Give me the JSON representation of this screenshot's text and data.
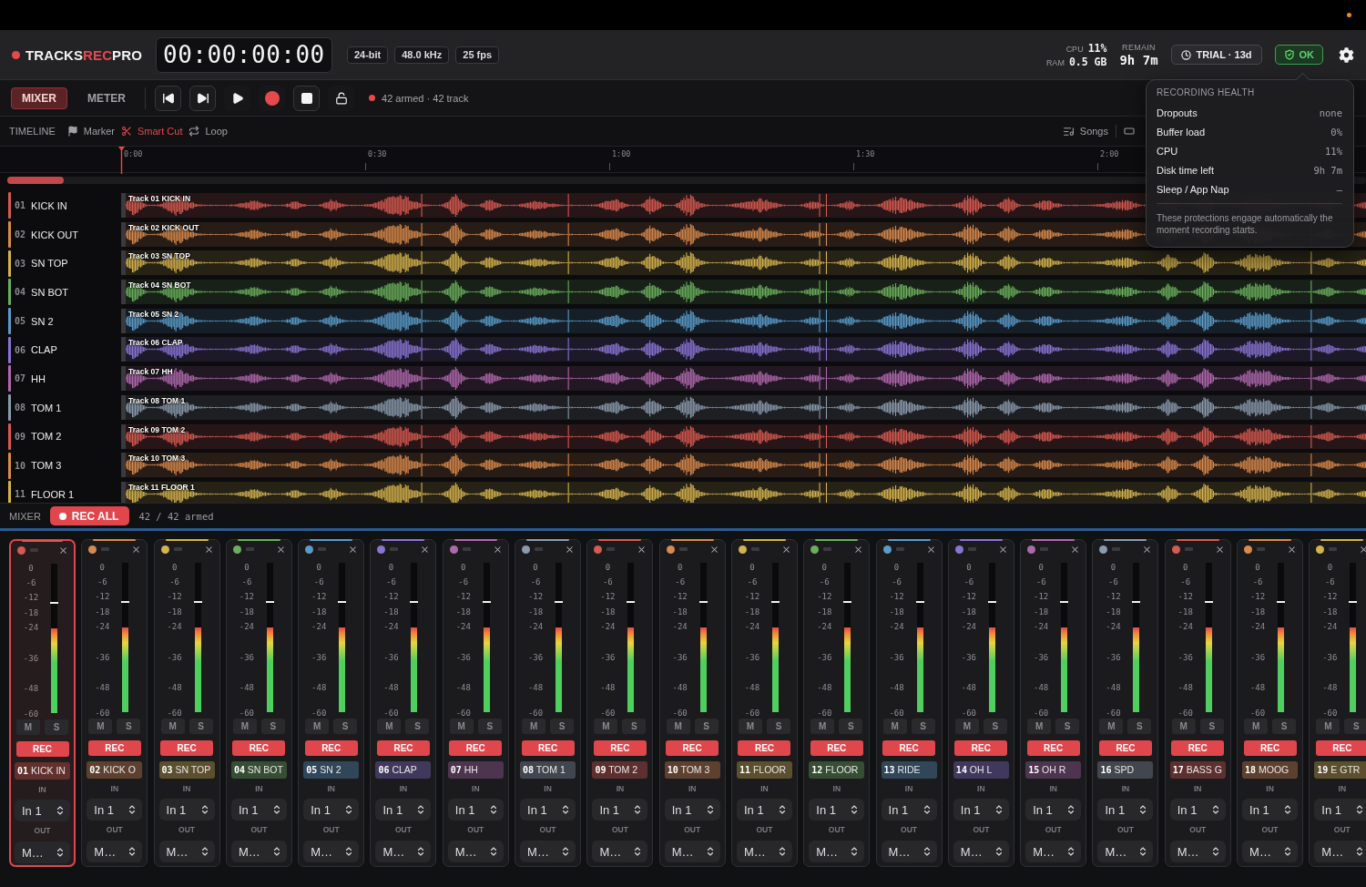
{
  "header": {
    "logo": [
      {
        "text": "TRACKS",
        "accent": false
      },
      {
        "text": "REC",
        "accent": true
      },
      {
        "text": "PRO",
        "accent": false
      }
    ],
    "timecode": "00:00:00:00",
    "format_badges": [
      "24-bit",
      "48.0 kHz",
      "25 fps"
    ],
    "stats": [
      {
        "label": "CPU",
        "value": "11%"
      },
      {
        "label": "RAM",
        "value": "0.5 GB"
      }
    ],
    "remain": {
      "label": "REMAIN",
      "value": "9h 7m"
    },
    "trial_button": "TRIAL · 13d",
    "health_button": {
      "label": "OK",
      "healthy": true
    }
  },
  "transport": {
    "view_tabs": [
      {
        "label": "MIXER",
        "selected": true
      },
      {
        "label": "METER",
        "selected": false
      }
    ],
    "status": "42 armed · 42 track"
  },
  "timeline_toolbar": {
    "title": "TIMELINE",
    "tools": [
      {
        "kind": "marker",
        "label": "Marker",
        "active": false
      },
      {
        "kind": "cut",
        "label": "Smart Cut",
        "active": true
      },
      {
        "kind": "loop",
        "label": "Loop",
        "active": false
      }
    ],
    "songs_button": "Songs"
  },
  "ruler": {
    "labels": [
      "0:00",
      "0:30",
      "1:00",
      "1:30",
      "2:00"
    ]
  },
  "tracks": [
    {
      "number": "01",
      "name": "KICK IN",
      "color": "#d65a50",
      "clip_label": "Track 01 KICK IN"
    },
    {
      "number": "02",
      "name": "KICK OUT",
      "color": "#d98a4c",
      "clip_label": "Track 02 KICK OUT"
    },
    {
      "number": "03",
      "name": "SN TOP",
      "color": "#d4b24c",
      "clip_label": "Track 03 SN TOP"
    },
    {
      "number": "04",
      "name": "SN BOT",
      "color": "#6aaf5c",
      "clip_label": "Track 04 SN BOT"
    },
    {
      "number": "05",
      "name": "SN 2",
      "color": "#5a9bc8",
      "clip_label": "Track 05 SN 2"
    },
    {
      "number": "06",
      "name": "CLAP",
      "color": "#8a74d4",
      "clip_label": "Track 06 CLAP"
    },
    {
      "number": "07",
      "name": "HH",
      "color": "#b068ad",
      "clip_label": "Track 07 HH"
    },
    {
      "number": "08",
      "name": "TOM 1",
      "color": "#8b9aac",
      "clip_label": "Track 08 TOM 1"
    },
    {
      "number": "09",
      "name": "TOM 2",
      "color": "#d65a50",
      "clip_label": "Track 09 TOM 2"
    },
    {
      "number": "10",
      "name": "TOM 3",
      "color": "#d98a4c",
      "clip_label": "Track 10 TOM 3"
    },
    {
      "number": "11",
      "name": "FLOOR 1",
      "color": "#d4b24c",
      "clip_label": "Track 11 FLOOR 1"
    }
  ],
  "health_popover": {
    "title": "RECORDING HEALTH",
    "rows": [
      {
        "label": "Dropouts",
        "value": "none"
      },
      {
        "label": "Buffer load",
        "value": "0%"
      },
      {
        "label": "CPU",
        "value": "11%"
      },
      {
        "label": "Disk time left",
        "value": "9h 7m"
      },
      {
        "label": "Sleep / App Nap",
        "value": "–"
      }
    ],
    "note": "These protections engage automatically the moment recording starts."
  },
  "mixer": {
    "title": "MIXER",
    "rec_all_button": "REC ALL",
    "armed_count": "42 / 42 armed",
    "strips": [
      {
        "color": "#d65a50",
        "selected": true,
        "scale": [
          "0",
          "-6",
          "-12",
          "-18",
          "-24",
          "-36",
          "-48",
          "-60"
        ],
        "meter": {
          "level": 0.57
        },
        "marker": {
          "level": 0.74
        },
        "mute": "M",
        "muted": false,
        "solo": "S",
        "soloed": false,
        "rec": "REC",
        "armed": true,
        "label": "**01** KICK IN",
        "in_label": "IN",
        "input": "In 1",
        "out_label": "OUT",
        "output": "M…"
      },
      {
        "color": "#d98a4c",
        "selected": false,
        "scale": [
          "0",
          "-6",
          "-12",
          "-18",
          "-24",
          "-36",
          "-48",
          "-60"
        ],
        "meter": {
          "level": 0.57
        },
        "marker": {
          "level": 0.74
        },
        "mute": "M",
        "muted": false,
        "solo": "S",
        "soloed": false,
        "rec": "REC",
        "armed": true,
        "label": "**02** KICK O",
        "in_label": "IN",
        "input": "In 1",
        "out_label": "OUT",
        "output": "M…"
      },
      {
        "color": "#d4b24c",
        "selected": false,
        "scale": [
          "0",
          "-6",
          "-12",
          "-18",
          "-24",
          "-36",
          "-48",
          "-60"
        ],
        "meter": {
          "level": 0.57
        },
        "marker": {
          "level": 0.74
        },
        "mute": "M",
        "muted": false,
        "solo": "S",
        "soloed": false,
        "rec": "REC",
        "armed": true,
        "label": "**03** SN TOP",
        "in_label": "IN",
        "input": "In 1",
        "out_label": "OUT",
        "output": "M…"
      },
      {
        "color": "#6aaf5c",
        "selected": false,
        "scale": [
          "0",
          "-6",
          "-12",
          "-18",
          "-24",
          "-36",
          "-48",
          "-60"
        ],
        "meter": {
          "level": 0.57
        },
        "marker": {
          "level": 0.74
        },
        "mute": "M",
        "muted": false,
        "solo": "S",
        "soloed": false,
        "rec": "REC",
        "armed": true,
        "label": "**04** SN BOT",
        "in_label": "IN",
        "input": "In 1",
        "out_label": "OUT",
        "output": "M…"
      },
      {
        "color": "#5a9bc8",
        "selected": false,
        "scale": [
          "0",
          "-6",
          "-12",
          "-18",
          "-24",
          "-36",
          "-48",
          "-60"
        ],
        "meter": {
          "level": 0.57
        },
        "marker": {
          "level": 0.74
        },
        "mute": "M",
        "muted": false,
        "solo": "S",
        "soloed": false,
        "rec": "REC",
        "armed": true,
        "label": "**05** SN 2",
        "in_label": "IN",
        "input": "In 1",
        "out_label": "OUT",
        "output": "M…"
      },
      {
        "color": "#8a74d4",
        "selected": false,
        "scale": [
          "0",
          "-6",
          "-12",
          "-18",
          "-24",
          "-36",
          "-48",
          "-60"
        ],
        "meter": {
          "level": 0.57
        },
        "marker": {
          "level": 0.74
        },
        "mute": "M",
        "muted": false,
        "solo": "S",
        "soloed": false,
        "rec": "REC",
        "armed": true,
        "label": "**06** CLAP",
        "in_label": "IN",
        "input": "In 1",
        "out_label": "OUT",
        "output": "M…"
      },
      {
        "color": "#b068ad",
        "selected": false,
        "scale": [
          "0",
          "-6",
          "-12",
          "-18",
          "-24",
          "-36",
          "-48",
          "-60"
        ],
        "meter": {
          "level": 0.57
        },
        "marker": {
          "level": 0.74
        },
        "mute": "M",
        "muted": false,
        "solo": "S",
        "soloed": false,
        "rec": "REC",
        "armed": true,
        "label": "**07** HH",
        "in_label": "IN",
        "input": "In 1",
        "out_label": "OUT",
        "output": "M…"
      },
      {
        "color": "#8b9aac",
        "selected": false,
        "scale": [
          "0",
          "-6",
          "-12",
          "-18",
          "-24",
          "-36",
          "-48",
          "-60"
        ],
        "meter": {
          "level": 0.57
        },
        "marker": {
          "level": 0.74
        },
        "mute": "M",
        "muted": false,
        "solo": "S",
        "soloed": false,
        "rec": "REC",
        "armed": true,
        "label": "**08** TOM 1",
        "in_label": "IN",
        "input": "In 1",
        "out_label": "OUT",
        "output": "M…"
      },
      {
        "color": "#d65a50",
        "selected": false,
        "scale": [
          "0",
          "-6",
          "-12",
          "-18",
          "-24",
          "-36",
          "-48",
          "-60"
        ],
        "meter": {
          "level": 0.57
        },
        "marker": {
          "level": 0.74
        },
        "mute": "M",
        "muted": false,
        "solo": "S",
        "soloed": false,
        "rec": "REC",
        "armed": true,
        "label": "**09** TOM 2",
        "in_label": "IN",
        "input": "In 1",
        "out_label": "OUT",
        "output": "M…"
      },
      {
        "color": "#d98a4c",
        "selected": false,
        "scale": [
          "0",
          "-6",
          "-12",
          "-18",
          "-24",
          "-36",
          "-48",
          "-60"
        ],
        "meter": {
          "level": 0.57
        },
        "marker": {
          "level": 0.74
        },
        "mute": "M",
        "muted": false,
        "solo": "S",
        "soloed": false,
        "rec": "REC",
        "armed": true,
        "label": "**10** TOM 3",
        "in_label": "IN",
        "input": "In 1",
        "out_label": "OUT",
        "output": "M…"
      },
      {
        "color": "#d4b24c",
        "selected": false,
        "scale": [
          "0",
          "-6",
          "-12",
          "-18",
          "-24",
          "-36",
          "-48",
          "-60"
        ],
        "meter": {
          "level": 0.57
        },
        "marker": {
          "level": 0.74
        },
        "mute": "M",
        "muted": false,
        "solo": "S",
        "soloed": false,
        "rec": "REC",
        "armed": true,
        "label": "**11** FLOOR",
        "in_label": "IN",
        "input": "In 1",
        "out_label": "OUT",
        "output": "M…"
      },
      {
        "color": "#6aaf5c",
        "selected": false,
        "scale": [
          "0",
          "-6",
          "-12",
          "-18",
          "-24",
          "-36",
          "-48",
          "-60"
        ],
        "meter": {
          "level": 0.57
        },
        "marker": {
          "level": 0.74
        },
        "mute": "M",
        "muted": false,
        "solo": "S",
        "soloed": false,
        "rec": "REC",
        "armed": true,
        "label": "**12** FLOOR",
        "in_label": "IN",
        "input": "In 1",
        "out_label": "OUT",
        "output": "M…"
      },
      {
        "color": "#5a9bc8",
        "selected": false,
        "scale": [
          "0",
          "-6",
          "-12",
          "-18",
          "-24",
          "-36",
          "-48",
          "-60"
        ],
        "meter": {
          "level": 0.57
        },
        "marker": {
          "level": 0.74
        },
        "mute": "M",
        "muted": false,
        "solo": "S",
        "soloed": false,
        "rec": "REC",
        "armed": true,
        "label": "**13** RIDE",
        "in_label": "IN",
        "input": "In 1",
        "out_label": "OUT",
        "output": "M…"
      },
      {
        "color": "#8a74d4",
        "selected": false,
        "scale": [
          "0",
          "-6",
          "-12",
          "-18",
          "-24",
          "-36",
          "-48",
          "-60"
        ],
        "meter": {
          "level": 0.57
        },
        "marker": {
          "level": 0.74
        },
        "mute": "M",
        "muted": false,
        "solo": "S",
        "soloed": false,
        "rec": "REC",
        "armed": true,
        "label": "**14** OH L",
        "in_label": "IN",
        "input": "In 1",
        "out_label": "OUT",
        "output": "M…"
      },
      {
        "color": "#b068ad",
        "selected": false,
        "scale": [
          "0",
          "-6",
          "-12",
          "-18",
          "-24",
          "-36",
          "-48",
          "-60"
        ],
        "meter": {
          "level": 0.57
        },
        "marker": {
          "level": 0.74
        },
        "mute": "M",
        "muted": false,
        "solo": "S",
        "soloed": false,
        "rec": "REC",
        "armed": true,
        "label": "**15** OH R",
        "in_label": "IN",
        "input": "In 1",
        "out_label": "OUT",
        "output": "M…"
      },
      {
        "color": "#8b9aac",
        "selected": false,
        "scale": [
          "0",
          "-6",
          "-12",
          "-18",
          "-24",
          "-36",
          "-48",
          "-60"
        ],
        "meter": {
          "level": 0.57
        },
        "marker": {
          "level": 0.74
        },
        "mute": "M",
        "muted": false,
        "solo": "S",
        "soloed": false,
        "rec": "REC",
        "armed": true,
        "label": "**16** SPD",
        "in_label": "IN",
        "input": "In 1",
        "out_label": "OUT",
        "output": "M…"
      },
      {
        "color": "#d65a50",
        "selected": false,
        "scale": [
          "0",
          "-6",
          "-12",
          "-18",
          "-24",
          "-36",
          "-48",
          "-60"
        ],
        "meter": {
          "level": 0.57
        },
        "marker": {
          "level": 0.74
        },
        "mute": "M",
        "muted": false,
        "solo": "S",
        "soloed": false,
        "rec": "REC",
        "armed": true,
        "label": "**17** BASS G",
        "in_label": "IN",
        "input": "In 1",
        "out_label": "OUT",
        "output": "M…"
      },
      {
        "color": "#d98a4c",
        "selected": false,
        "scale": [
          "0",
          "-6",
          "-12",
          "-18",
          "-24",
          "-36",
          "-48",
          "-60"
        ],
        "meter": {
          "level": 0.57
        },
        "marker": {
          "level": 0.74
        },
        "mute": "M",
        "muted": false,
        "solo": "S",
        "soloed": false,
        "rec": "REC",
        "armed": true,
        "label": "**18** MOOG",
        "in_label": "IN",
        "input": "In 1",
        "out_label": "OUT",
        "output": "M…"
      },
      {
        "color": "#d4b24c",
        "selected": false,
        "scale": [
          "0",
          "-6",
          "-12",
          "-18",
          "-24",
          "-36",
          "-48",
          "-60"
        ],
        "meter": {
          "level": 0.57
        },
        "marker": {
          "level": 0.74
        },
        "mute": "M",
        "muted": false,
        "solo": "S",
        "soloed": false,
        "rec": "REC",
        "armed": true,
        "label": "**19** E GTR",
        "in_label": "IN",
        "input": "In 1",
        "out_label": "OUT",
        "output": "M…"
      }
    ]
  }
}
